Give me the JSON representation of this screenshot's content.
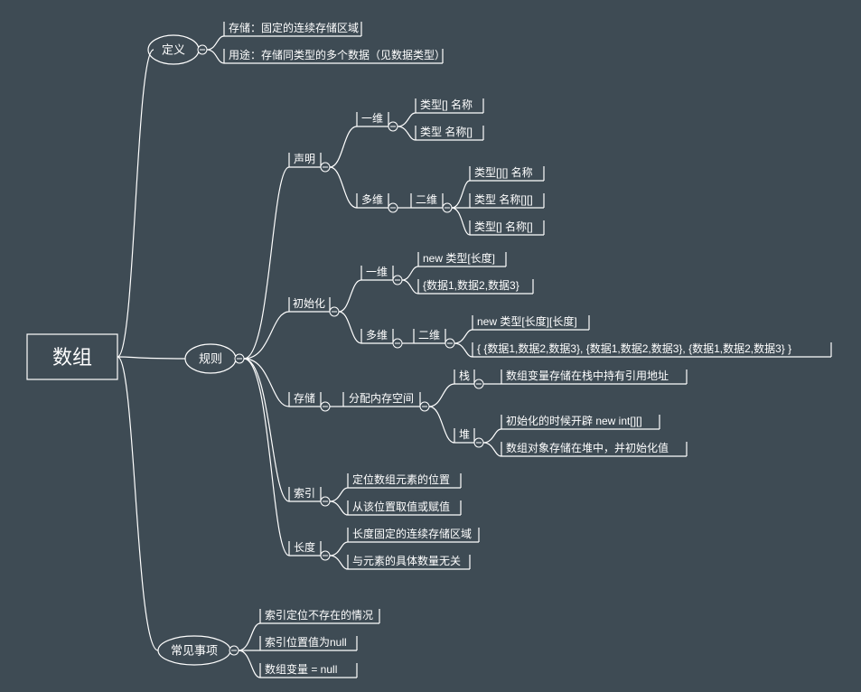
{
  "root": {
    "label": "数组"
  },
  "nodes": {
    "definition": {
      "label": "定义"
    },
    "def_storage": "存储：固定的连续存储区域",
    "def_usage": "用途：存储同类型的多个数据（见数据类型）",
    "rules": {
      "label": "规则"
    },
    "decl": "声明",
    "decl_1d": "一维",
    "decl_1d_a": "类型[] 名称",
    "decl_1d_b": "类型 名称[]",
    "decl_md": "多维",
    "decl_2d": "二维",
    "decl_2d_a": "类型[][] 名称",
    "decl_2d_b": "类型 名称[][]",
    "decl_2d_c": "类型[] 名称[]",
    "init": "初始化",
    "init_1d": "一维",
    "init_1d_a": "new 类型[长度]",
    "init_1d_b": "{数据1,数据2,数据3}",
    "init_md": "多维",
    "init_2d": "二维",
    "init_2d_a": "new 类型[长度][长度]",
    "init_2d_b": "{ {数据1,数据2,数据3}, {数据1,数据2,数据3}, {数据1,数据2,数据3} }",
    "storage": "存储",
    "alloc": "分配内存空间",
    "stack": "栈",
    "stack_a": "数组变量存储在栈中持有引用地址",
    "heap": "堆",
    "heap_a": "初始化的时候开辟 new int[][]",
    "heap_b": "数组对象存储在堆中，并初始化值",
    "index": "索引",
    "index_a": "定位数组元素的位置",
    "index_b": "从该位置取值或赋值",
    "length": "长度",
    "length_a": "长度固定的连续存储区域",
    "length_b": "与元素的具体数量无关",
    "common": {
      "label": "常见事项"
    },
    "common_a": "索引定位不存在的情况",
    "common_b": "索引位置值为null",
    "common_c": "数组变量 = null"
  }
}
